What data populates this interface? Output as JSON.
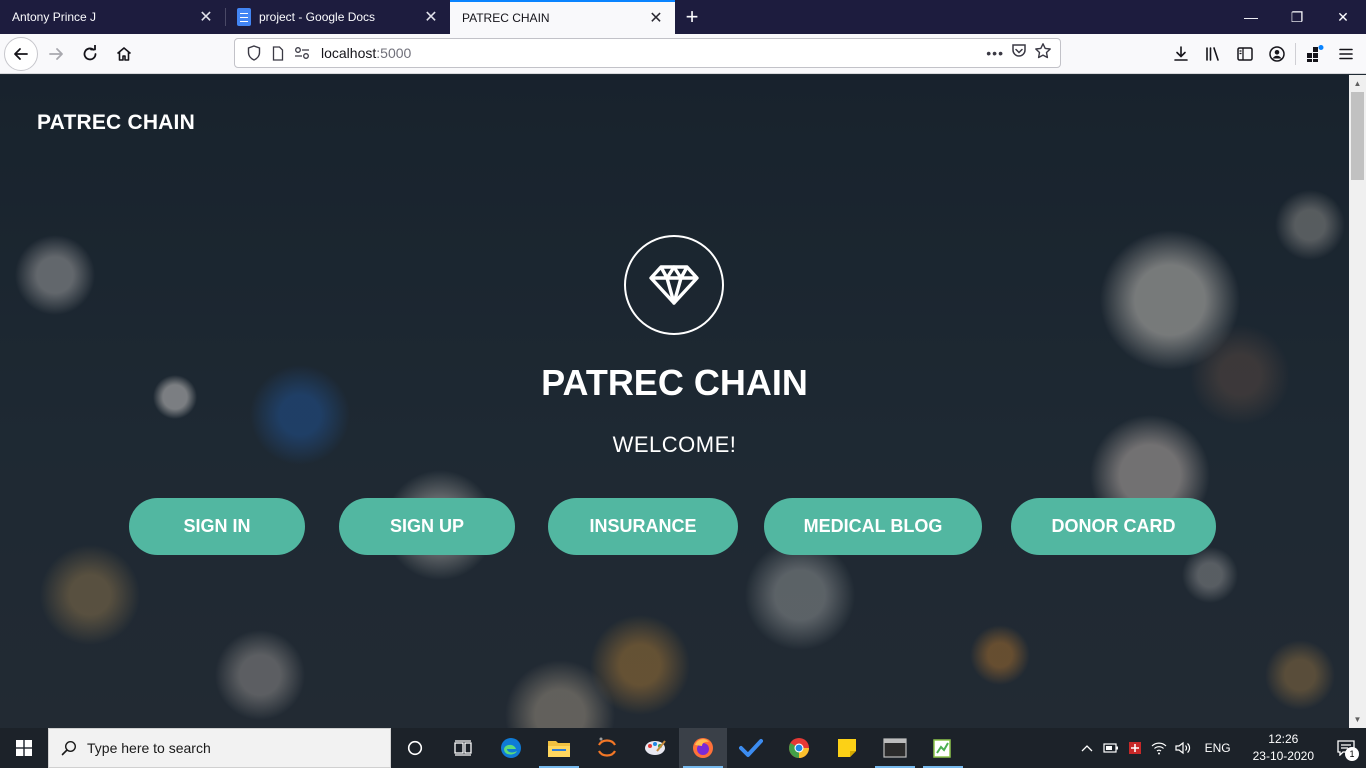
{
  "browser": {
    "tabs": [
      {
        "label": "Antony Prince J",
        "close": "✕"
      },
      {
        "label": "project - Google Docs",
        "close": "✕"
      },
      {
        "label": "PATREC CHAIN",
        "close": "✕"
      }
    ],
    "new_tab": "+",
    "window_controls": {
      "minimize": "—",
      "restore": "❐",
      "close": "✕"
    },
    "url": {
      "host": "localhost",
      "port": ":5000"
    },
    "url_more": "•••"
  },
  "page": {
    "brand": "PATREC CHAIN",
    "hero_icon": "diamond-icon",
    "title": "PATREC CHAIN",
    "subtitle": "WELCOME!",
    "buttons": {
      "sign_in": "SIGN IN",
      "sign_up": "SIGN UP",
      "insurance": "INSURANCE",
      "medical_blog": "MEDICAL BLOG",
      "donor_card": "DONOR CARD"
    },
    "accent_color": "#52b7a1"
  },
  "taskbar": {
    "search_placeholder": "Type here to search",
    "language": "ENG",
    "time": "12:26",
    "date": "23-10-2020",
    "notification_count": "1"
  }
}
